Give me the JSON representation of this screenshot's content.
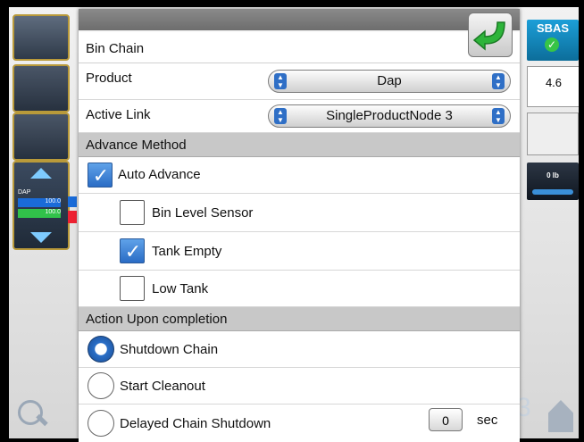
{
  "dialog": {
    "title": "Bin Chain",
    "product": {
      "label": "Product",
      "value": "Dap"
    },
    "active_link": {
      "label": "Active Link",
      "value": "SingleProductNode 3"
    },
    "advance_method": {
      "header": "Advance Method",
      "auto_advance": {
        "label": "Auto Advance",
        "checked": true
      },
      "bin_level_sensor": {
        "label": "Bin Level Sensor",
        "checked": false
      },
      "tank_empty": {
        "label": "Tank Empty",
        "checked": true
      },
      "low_tank": {
        "label": "Low Tank",
        "checked": false
      }
    },
    "action_upon_completion": {
      "header": "Action Upon completion",
      "shutdown_chain": {
        "label": "Shutdown Chain",
        "selected": true
      },
      "start_cleanout": {
        "label": "Start Cleanout",
        "selected": false
      },
      "delayed_chain_shutdown": {
        "label": "Delayed Chain Shutdown",
        "selected": false,
        "delay_value": "0",
        "unit": "sec"
      }
    }
  },
  "background": {
    "sbas_label": "SBAS",
    "area_value": "4.6",
    "tile_labels": [
      "DAP",
      "100.0",
      "100.0"
    ],
    "lbs_value": "0 lb"
  },
  "colors": {
    "accent_blue": "#2a6cc5",
    "ok_green": "#37c447"
  },
  "icons": [
    "ok-arrow-icon",
    "spin-left-icon",
    "spin-right-icon",
    "checkmark-icon",
    "magnifier-icon",
    "home-icon"
  ]
}
